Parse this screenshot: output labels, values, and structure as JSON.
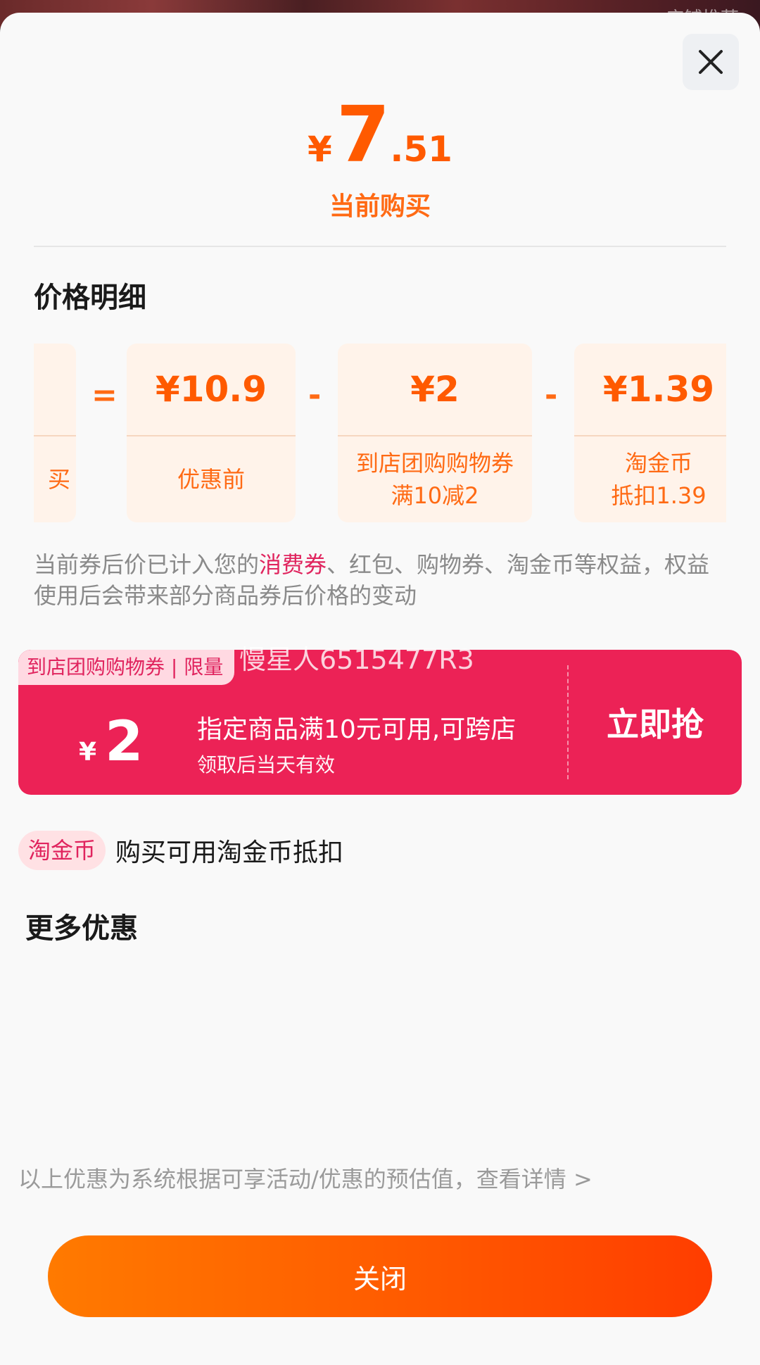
{
  "background": {
    "corner_text": "店铺推荐"
  },
  "header": {
    "price_symbol": "¥",
    "price_integer": "7",
    "price_decimal": ".51",
    "price_caption": "当前购买"
  },
  "price_detail": {
    "title": "价格明细",
    "first_card_partial_label": "买",
    "operators": [
      "=",
      "-",
      "-"
    ],
    "cards": [
      {
        "value": "¥10.9",
        "label": "优惠前"
      },
      {
        "value": "¥2",
        "label": "到店团购购物券\n满10减2"
      },
      {
        "value": "¥1.39",
        "label": "淘金币\n抵扣1.39"
      }
    ],
    "note_prefix": "当前券后价已计入您的",
    "note_highlight": "消费券",
    "note_suffix": "、红包、购物券、淘金币等权益，权益使用后会带来部分商品券后价格的变动"
  },
  "watermark": "慢星人6515477R3",
  "coupon": {
    "tag": "到店团购购物券 | 限量",
    "symbol": "¥",
    "amount": "2",
    "condition": "指定商品满10元可用,可跨店",
    "validity": "领取后当天有效",
    "cta": "立即抢"
  },
  "coin": {
    "badge": "淘金币",
    "text": "购买可用淘金币抵扣"
  },
  "more": {
    "title": "更多优惠"
  },
  "footnote": "以上优惠为系统根据可享活动/优惠的预估值，查看详情 >",
  "close_button": "关闭",
  "colors": {
    "accent_orange": "#ff5a00",
    "coupon_red": "#ec2256",
    "highlight_pink": "#e0245e"
  }
}
